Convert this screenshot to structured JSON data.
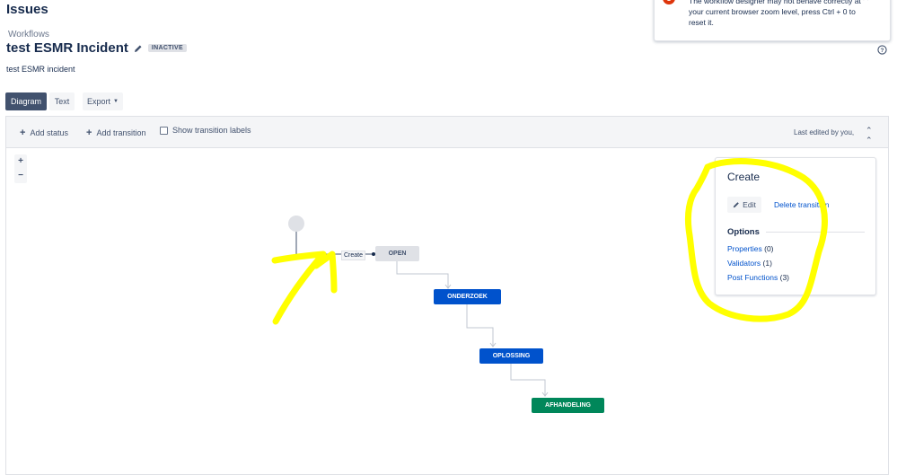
{
  "header": {
    "page_heading": "Issues",
    "breadcrumb": "Workflows",
    "title": "test ESMR Incident",
    "badge": "INACTIVE",
    "description": "test ESMR incident"
  },
  "view_buttons": {
    "diagram": "Diagram",
    "text": "Text",
    "export": "Export"
  },
  "notice": {
    "text": "The workflow designer may not behave correctly at your current browser zoom level, press Ctrl + 0 to reset it."
  },
  "toolbar": {
    "add_status": "Add status",
    "add_transition": "Add transition",
    "show_labels": "Show transition labels",
    "last_edited": "Last edited by you,"
  },
  "zoom": {
    "in": "+",
    "out": "−"
  },
  "diagram": {
    "transition_label": "Create",
    "statuses": {
      "open": "OPEN",
      "onderzoek": "ONDERZOEK",
      "oplossing": "OPLOSSING",
      "afhandeling": "AFHANDELING"
    }
  },
  "panel": {
    "title": "Create",
    "edit": "Edit",
    "delete": "Delete transition",
    "options_title": "Options",
    "properties": "Properties",
    "properties_count": "(0)",
    "validators": "Validators",
    "validators_count": "(1)",
    "post_functions": "Post Functions",
    "post_functions_count": "(3)"
  },
  "colors": {
    "status_blue": "#0052cc",
    "status_green": "#00875a",
    "annotation": "#ffff00"
  }
}
